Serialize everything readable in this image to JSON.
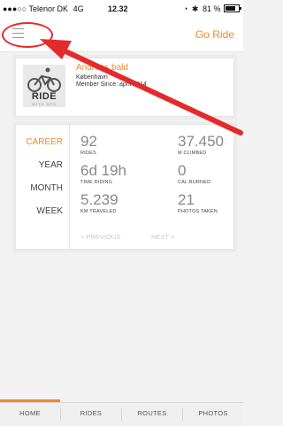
{
  "status_bar": {
    "carrier": "●●●○○ Telenor DK",
    "network": "4G",
    "time": "12.32",
    "battery": "81 %"
  },
  "navbar": {
    "menu_icon": "hamburger-icon",
    "go_ride_label": "Go Ride"
  },
  "profile": {
    "logo_text": "RIDE",
    "logo_sub": "WITH GPS",
    "name": "Andreas bald",
    "city": "København",
    "member_since": "Member Since: april 2014"
  },
  "stats": {
    "periods": [
      "CAREER",
      "YEAR",
      "MONTH",
      "WEEK"
    ],
    "active_period": "CAREER",
    "items": [
      {
        "value": "92",
        "label": "RIDES"
      },
      {
        "value": "37.450",
        "label": "M CLIMBED"
      },
      {
        "value": "6d 19h",
        "label": "TIME RIDING"
      },
      {
        "value": "0",
        "label": "CAL BURNED"
      },
      {
        "value": "5.239",
        "label": "KM TRAVELED"
      },
      {
        "value": "21",
        "label": "PHOTOS TAKEN"
      }
    ],
    "previous_label": "< PREVIOUS",
    "next_label": "NEXT >"
  },
  "tabs": [
    "HOME",
    "RIDES",
    "ROUTES",
    "PHOTOS"
  ],
  "colors": {
    "accent": "#f08a24",
    "annotation": "#e42b2b"
  }
}
